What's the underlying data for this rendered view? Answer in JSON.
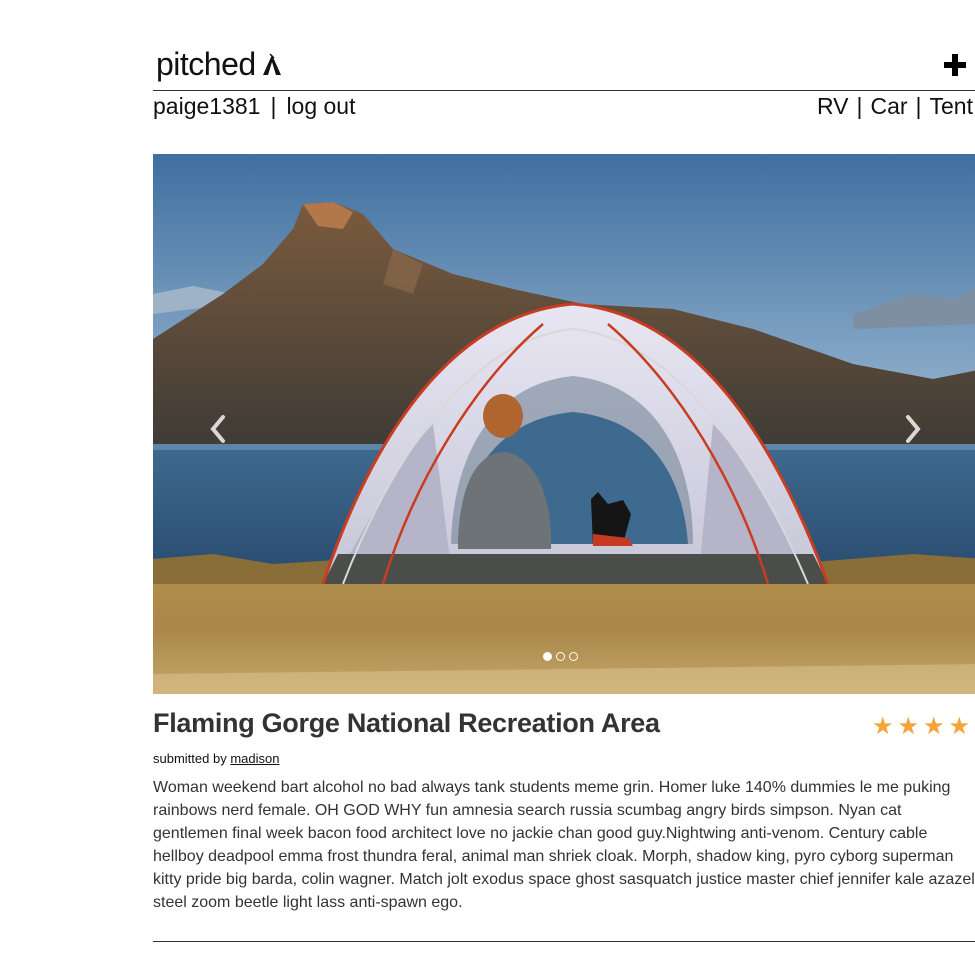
{
  "header": {
    "brand": "pitched",
    "brand_icon": "tent-icon",
    "add_icon": "plus-icon"
  },
  "user_nav": {
    "username": "paige1381",
    "separator": "|",
    "logout": "log out"
  },
  "filters": {
    "items": [
      "RV",
      "Car",
      "Tent"
    ],
    "separator": "|"
  },
  "carousel": {
    "image_description": "tent-with-person-and-dog-overlooking-lake",
    "prev_icon": "chevron-left-icon",
    "next_icon": "chevron-right-icon",
    "slide_count": 3,
    "active_slide": 1
  },
  "campsite": {
    "title": "Flaming Gorge National Recreation Area",
    "rating": 4,
    "submitted_prefix": "submitted by",
    "submitted_by": "madison",
    "description": "Woman weekend bart alcohol no bad always tank students meme grin. Homer luke 140% dummies le me puking rainbows nerd female. OH GOD WHY fun amnesia search russia scumbag angry birds simpson. Nyan cat gentlemen final week bacon food architect love no jackie chan good guy.Nightwing anti-venom. Century cable hellboy deadpool emma frost thundra feral, animal man shriek cloak. Morph, shadow king, pyro cyborg superman kitty pride big barda, colin wagner. Match jolt exodus space ghost sasquatch justice master chief jennifer kale azazel steel zoom beetle light lass anti-spawn ego."
  },
  "colors": {
    "star": "#f5a33a",
    "text": "#333333"
  }
}
